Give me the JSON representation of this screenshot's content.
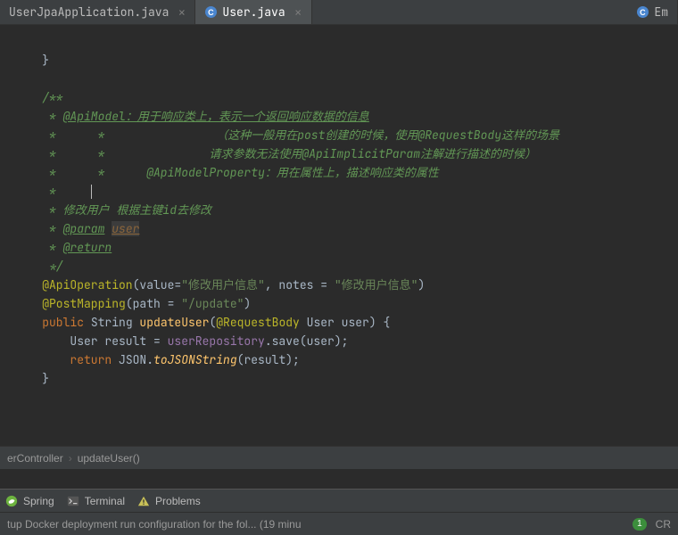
{
  "tabs": {
    "t0": {
      "label": "UserJpaApplication.java"
    },
    "t1": {
      "label": "User.java"
    },
    "t2": {
      "label": "Em"
    }
  },
  "code": {
    "l1": "    }",
    "l2": "",
    "l3": "    /**",
    "l4a": "     * ",
    "l4b": "@ApiModel：用于响应类上，表示一个返回响应数据的信息",
    "l5": "     *      *                （这种一般用在post创建的时候，使用@RequestBody这样的场景",
    "l6": "     *      *               请求参数无法使用@ApiImplicitParam注解进行描述的时候）",
    "l7": "     *      *      @ApiModelProperty：用在属性上，描述响应类的属性",
    "l8": "     *     ",
    "l9": "     * 修改用户 根据主键id去修改",
    "l10a": "     * ",
    "l10b": "@param",
    "l10c": " ",
    "l10d": "user",
    "l11a": "     * ",
    "l11b": "@return",
    "l12": "     */",
    "l13_anno": "    @ApiOperation",
    "l13_rest1": "(value=",
    "l13_str1": "\"修改用户信息\"",
    "l13_rest2": ", notes = ",
    "l13_str2": "\"修改用户信息\"",
    "l13_rest3": ")",
    "l14_anno": "    @PostMapping",
    "l14_rest1": "(path = ",
    "l14_str": "\"/update\"",
    "l14_rest2": ")",
    "l15_kw1": "    public ",
    "l15_cls1": "String ",
    "l15_fn": "updateUser",
    "l15_rest1": "(",
    "l15_anno": "@RequestBody",
    "l15_rest2": " User user) {",
    "l16_a": "        User result = ",
    "l16_field": "userRepository",
    "l16_b": ".save(user);",
    "l17_a": "        ",
    "l17_kw": "return ",
    "l17_cls": "JSON.",
    "l17_fn": "toJSONString",
    "l17_b": "(result);",
    "l18": "    }"
  },
  "breadcrumb": {
    "p0": "erController",
    "p1": "updateUser()"
  },
  "toolwindows": {
    "spring": "Spring",
    "terminal": "Terminal",
    "problems": "Problems"
  },
  "status": {
    "msg": "tup Docker deployment run configuration for the fol... (19 minu",
    "badge": "1",
    "enc": "CR"
  },
  "icons": {
    "class_letter": "C",
    "close": "×"
  }
}
